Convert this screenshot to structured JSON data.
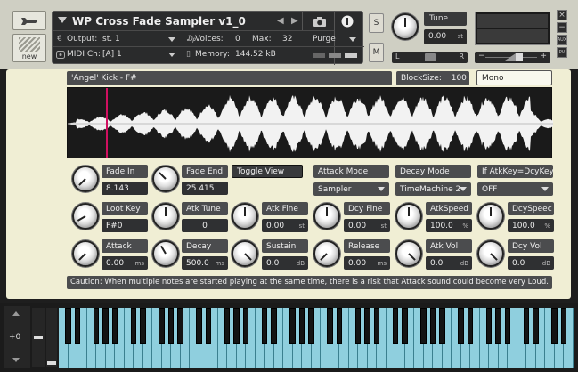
{
  "header": {
    "title": "WP Cross Fade Sampler v1_0",
    "new_label": "new",
    "output_label": "Output:",
    "output_value": "st. 1",
    "voices_label": "Voices:",
    "voices_value": "0",
    "max_label": "Max:",
    "max_value": "32",
    "purge_label": "Purge",
    "midi_label": "MIDI Ch:",
    "midi_value": "[A]  1",
    "memory_label": "Memory:",
    "memory_value": "144.52 kB",
    "s_label": "S",
    "m_label": "M",
    "tune_label": "Tune",
    "tune_value": "0.00",
    "tune_unit": "st",
    "pan_left": "L",
    "pan_right": "R",
    "aux_label": "AUX",
    "pv_label": "PV",
    "close_label": "×",
    "minimize_label": "−"
  },
  "main": {
    "sample_name": "'Angel' Kick - F#",
    "blocksize_label": "BlockSize:",
    "blocksize_value": "100",
    "channel_mode": "Mono",
    "toggle_view": "Toggle View",
    "attack_mode_label": "Attack Mode",
    "attack_mode_value": "Sampler",
    "decay_mode_label": "Decay Mode",
    "decay_mode_value": "TimeMachine 2",
    "if_label": "If AtkKey=DcyKey",
    "if_value": "OFF",
    "caution": "Caution: When multiple notes are started playing at the same time, there is a risk that Attack sound could become very Loud."
  },
  "controls": {
    "fade_in": {
      "label": "Fade In",
      "value": "8.143",
      "unit": ""
    },
    "fade_end": {
      "label": "Fade End",
      "value": "25.415",
      "unit": ""
    },
    "loot_key": {
      "label": "Loot Key",
      "value": "F#0",
      "unit": ""
    },
    "atk_tune": {
      "label": "Atk Tune",
      "value": "0",
      "unit": ""
    },
    "atk_fine": {
      "label": "Atk Fine",
      "value": "0.00",
      "unit": "st"
    },
    "dcy_fine": {
      "label": "Dcy Fine",
      "value": "0.00",
      "unit": "st"
    },
    "atk_speed": {
      "label": "AtkSpeed",
      "value": "100.0",
      "unit": "%"
    },
    "dcy_speed": {
      "label": "DcySpeec",
      "value": "100.0",
      "unit": "%"
    },
    "attack": {
      "label": "Attack",
      "value": "0.00",
      "unit": "ms"
    },
    "decay": {
      "label": "Decay",
      "value": "500.0",
      "unit": "ms"
    },
    "sustain": {
      "label": "Sustain",
      "value": "0.0",
      "unit": "dB"
    },
    "release": {
      "label": "Release",
      "value": "0.00",
      "unit": "ms"
    },
    "atk_vol": {
      "label": "Atk Vol",
      "value": "0.0",
      "unit": "dB"
    },
    "dcy_vol": {
      "label": "Dcy Vol",
      "value": "0.0",
      "unit": "dB"
    }
  },
  "keyboard": {
    "octave_value": "+0"
  }
}
